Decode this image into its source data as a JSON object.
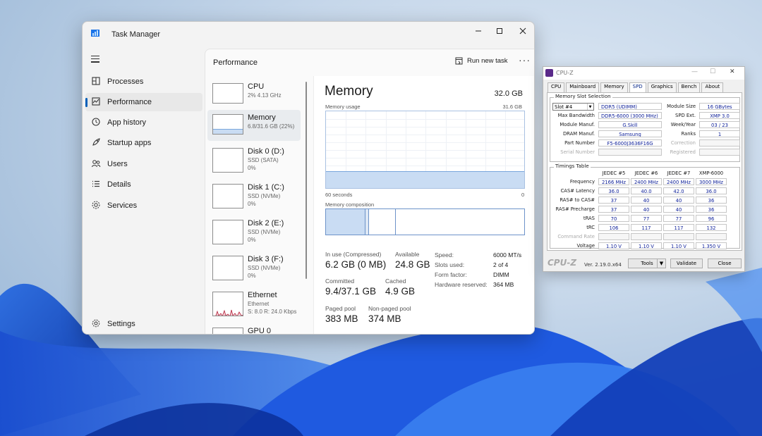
{
  "task_manager": {
    "title": "Task Manager",
    "nav": [
      {
        "label": "Processes",
        "icon": "processes-icon"
      },
      {
        "label": "Performance",
        "icon": "performance-icon"
      },
      {
        "label": "App history",
        "icon": "app-history-icon"
      },
      {
        "label": "Startup apps",
        "icon": "startup-apps-icon"
      },
      {
        "label": "Users",
        "icon": "users-icon"
      },
      {
        "label": "Details",
        "icon": "details-icon"
      },
      {
        "label": "Services",
        "icon": "services-icon"
      }
    ],
    "settings_label": "Settings",
    "section_title": "Performance",
    "run_new_task": "Run new task",
    "more": "···",
    "perf_items": [
      {
        "name": "CPU",
        "sub1": "2% 4.13 GHz",
        "sub2": ""
      },
      {
        "name": "Memory",
        "sub1": "6.8/31.6 GB (22%)",
        "sub2": ""
      },
      {
        "name": "Disk 0 (D:)",
        "sub1": "SSD (SATA)",
        "sub2": "0%"
      },
      {
        "name": "Disk 1 (C:)",
        "sub1": "SSD (NVMe)",
        "sub2": "0%"
      },
      {
        "name": "Disk 2 (E:)",
        "sub1": "SSD (NVMe)",
        "sub2": "0%"
      },
      {
        "name": "Disk 3 (F:)",
        "sub1": "SSD (NVMe)",
        "sub2": "0%"
      },
      {
        "name": "Ethernet",
        "sub1": "Ethernet",
        "sub2": "S: 8.0 R: 24.0 Kbps"
      },
      {
        "name": "GPU 0",
        "sub1": "",
        "sub2": ""
      }
    ],
    "memory": {
      "title": "Memory",
      "total": "32.0 GB",
      "usage_label": "Memory usage",
      "usage_max": "31.6 GB",
      "usage_fraction": 0.22,
      "time_left": "60 seconds",
      "time_right": "0",
      "composition_label": "Memory composition",
      "in_use_label": "In use (Compressed)",
      "in_use_value": "6.2 GB (0 MB)",
      "available_label": "Available",
      "available_value": "24.8 GB",
      "committed_label": "Committed",
      "committed_value": "9.4/37.1 GB",
      "cached_label": "Cached",
      "cached_value": "4.9 GB",
      "paged_label": "Paged pool",
      "paged_value": "383 MB",
      "nonpaged_label": "Non-paged pool",
      "nonpaged_value": "374 MB",
      "props": [
        {
          "k": "Speed:",
          "v": "6000 MT/s"
        },
        {
          "k": "Slots used:",
          "v": "2 of 4"
        },
        {
          "k": "Form factor:",
          "v": "DIMM"
        },
        {
          "k": "Hardware reserved:",
          "v": "364 MB"
        }
      ]
    }
  },
  "cpuz": {
    "title": "CPU-Z",
    "tabs": [
      "CPU",
      "Mainboard",
      "Memory",
      "SPD",
      "Graphics",
      "Bench",
      "About"
    ],
    "active_tab": "SPD",
    "slot_group": "Memory Slot Selection",
    "slot": "Slot #4",
    "module_type": "DDR5 (UDIMM)",
    "left_rows": [
      {
        "label": "Max Bandwidth",
        "value": "DDR5-6000 (3000 MHz)"
      },
      {
        "label": "Module Manuf.",
        "value": "G.Skill"
      },
      {
        "label": "DRAM Manuf.",
        "value": "Samsung"
      },
      {
        "label": "Part Number",
        "value": "F5-6000J3636F16G"
      },
      {
        "label": "Serial Number",
        "value": ""
      }
    ],
    "right_rows": [
      {
        "label": "Module Size",
        "value": "16 GBytes"
      },
      {
        "label": "SPD Ext.",
        "value": "XMP 3.0"
      },
      {
        "label": "Week/Year",
        "value": "03 / 23"
      },
      {
        "label": "Ranks",
        "value": "1"
      },
      {
        "label": "Correction",
        "value": ""
      },
      {
        "label": "Registered",
        "value": ""
      }
    ],
    "timings_group": "Timings Table",
    "timing_cols": [
      "JEDEC #5",
      "JEDEC #6",
      "JEDEC #7",
      "XMP-6000"
    ],
    "timing_rows": [
      {
        "label": "Frequency",
        "values": [
          "2166 MHz",
          "2400 MHz",
          "2400 MHz",
          "3000 MHz"
        ]
      },
      {
        "label": "CAS# Latency",
        "values": [
          "36.0",
          "40.0",
          "42.0",
          "36.0"
        ]
      },
      {
        "label": "RAS# to CAS#",
        "values": [
          "37",
          "40",
          "40",
          "36"
        ]
      },
      {
        "label": "RAS# Precharge",
        "values": [
          "37",
          "40",
          "40",
          "36"
        ]
      },
      {
        "label": "tRAS",
        "values": [
          "70",
          "77",
          "77",
          "96"
        ]
      },
      {
        "label": "tRC",
        "values": [
          "106",
          "117",
          "117",
          "132"
        ]
      },
      {
        "label": "Command Rate",
        "values": [
          "",
          "",
          "",
          ""
        ]
      },
      {
        "label": "Voltage",
        "values": [
          "1.10 V",
          "1.10 V",
          "1.10 V",
          "1.350 V"
        ]
      }
    ],
    "logo": "CPU-Z",
    "version": "Ver. 2.19.0.x64",
    "tools_label": "Tools",
    "validate_label": "Validate",
    "close_label": "Close"
  }
}
